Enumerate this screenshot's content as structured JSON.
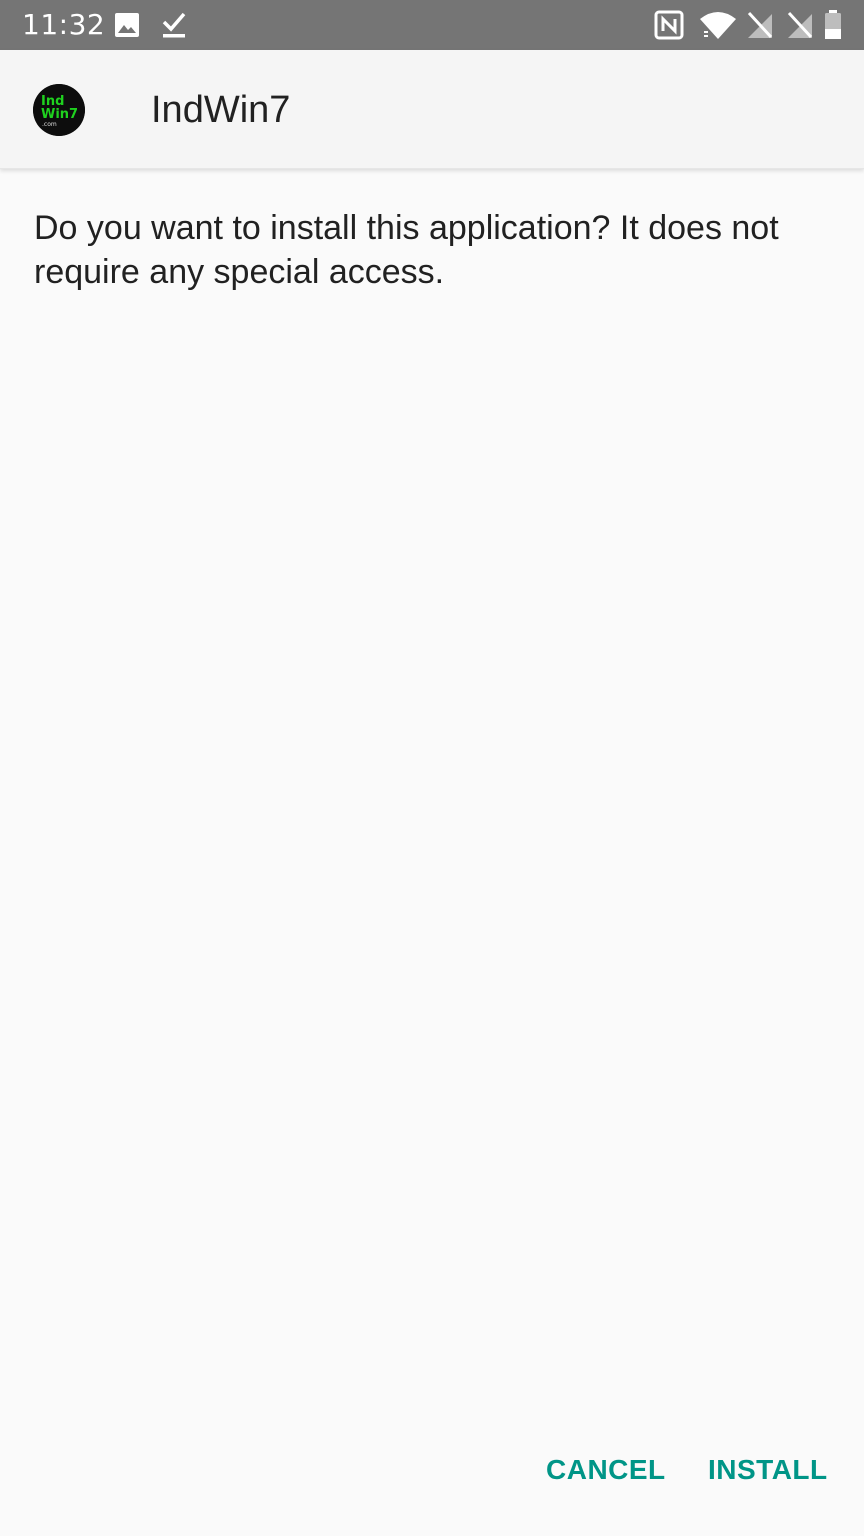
{
  "status_bar": {
    "time": "11:32",
    "icons": [
      "image-icon",
      "check-download-icon",
      "nfc-icon",
      "wifi-icon",
      "no-sim-icon",
      "no-sim-2-icon",
      "battery-icon"
    ]
  },
  "app": {
    "name": "IndWin7",
    "icon_line1": "Ind",
    "icon_line2": "Win7",
    "icon_line3": ".com",
    "icon_color": "#1fd11f"
  },
  "dialog": {
    "message": "Do you want to install this application? It does not require any special access."
  },
  "buttons": {
    "cancel": "CANCEL",
    "install": "INSTALL"
  },
  "colors": {
    "status_bar_bg": "#757575",
    "app_bar_bg": "#f5f5f5",
    "background": "#fafafa",
    "accent": "#009587",
    "text": "#212121"
  }
}
